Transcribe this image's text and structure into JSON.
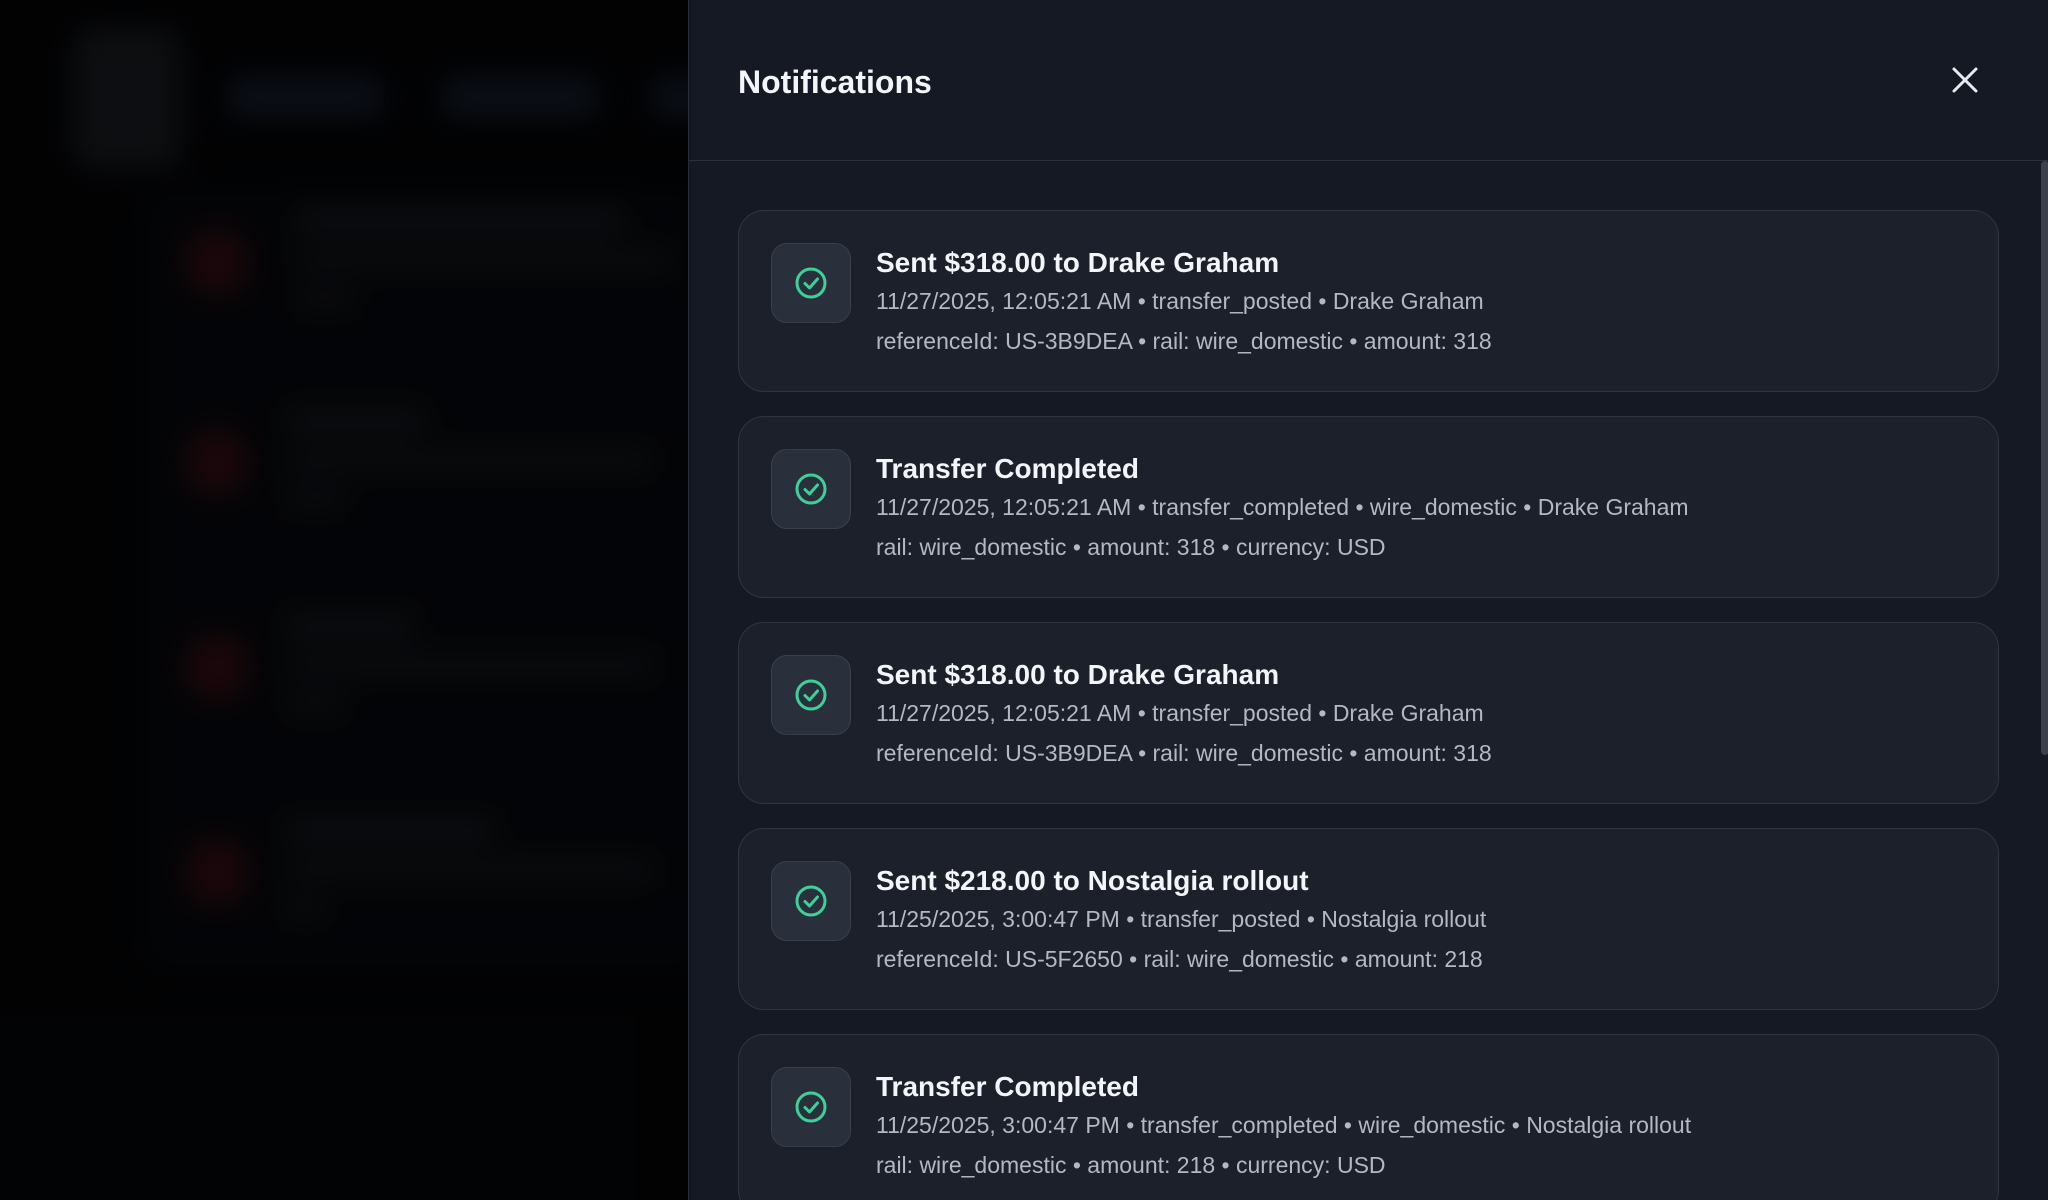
{
  "drawer": {
    "title": "Notifications"
  },
  "colors": {
    "accent_success": "#3ecf9a",
    "drawer_background": "#141923",
    "card_background": "#1b202b"
  },
  "notifications": [
    {
      "icon": "check-circle-icon",
      "title": "Sent $318.00 to Drake Graham",
      "meta": "11/27/2025, 12:05:21 AM • transfer_posted • Drake Graham",
      "detail": "referenceId: US-3B9DEA • rail: wire_domestic • amount: 318"
    },
    {
      "icon": "check-circle-icon",
      "title": "Transfer Completed",
      "meta": "11/27/2025, 12:05:21 AM • transfer_completed • wire_domestic • Drake Graham",
      "detail": "rail: wire_domestic • amount: 318 • currency: USD"
    },
    {
      "icon": "check-circle-icon",
      "title": "Sent $318.00 to Drake Graham",
      "meta": "11/27/2025, 12:05:21 AM • transfer_posted • Drake Graham",
      "detail": "referenceId: US-3B9DEA • rail: wire_domestic • amount: 318"
    },
    {
      "icon": "check-circle-icon",
      "title": "Sent $218.00 to Nostalgia rollout",
      "meta": "11/25/2025, 3:00:47 PM • transfer_posted • Nostalgia rollout",
      "detail": "referenceId: US-5F2650 • rail: wire_domestic • amount: 218"
    },
    {
      "icon": "check-circle-icon",
      "title": "Transfer Completed",
      "meta": "11/25/2025, 3:00:47 PM • transfer_completed • wire_domestic • Nostalgia rollout",
      "detail": "rail: wire_domestic • amount: 218 • currency: USD"
    }
  ]
}
